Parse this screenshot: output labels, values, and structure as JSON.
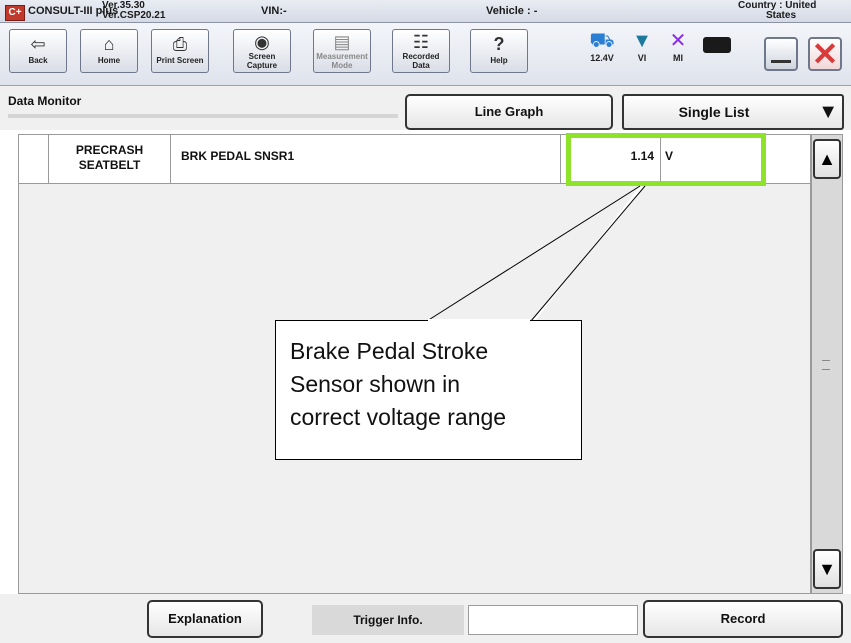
{
  "titlebar": {
    "app_name": "CONSULT-III plus",
    "version_line1": "Ver.35.30",
    "version_line2": "Ver.CSP20.21",
    "vin": "VIN:-",
    "vehicle": "Vehicle : -",
    "country_line1": "Country : United",
    "country_line2": "States",
    "logo_text": "C+"
  },
  "toolbar": {
    "buttons": [
      {
        "label": "Back",
        "icon": "back-arrow-icon"
      },
      {
        "label": "Home",
        "icon": "home-icon"
      },
      {
        "label": "Print Screen",
        "icon": "printer-icon"
      },
      {
        "label_line1": "Screen",
        "label_line2": "Capture",
        "icon": "camera-icon"
      },
      {
        "label_line1": "Measurement",
        "label_line2": "Mode",
        "icon": "measurement-icon",
        "disabled": true
      },
      {
        "label_line1": "Recorded",
        "label_line2": "Data",
        "icon": "recorded-data-icon"
      },
      {
        "label": "Help",
        "icon": "help-icon"
      }
    ],
    "status": {
      "battery_voltage": "12.4V",
      "vi": "VI",
      "mi": "MI"
    }
  },
  "panel": {
    "title": "Data Monitor",
    "line_graph_label": "Line Graph",
    "single_list_label": "Single List"
  },
  "table": {
    "rows": [
      {
        "system_line1": "PRECRASH",
        "system_line2": "SEATBELT",
        "item": "BRK PEDAL SNSR1",
        "value": "1.14",
        "unit": "V"
      }
    ]
  },
  "callout": {
    "line1": "Brake Pedal Stroke",
    "line2": "Sensor shown in",
    "line3": "correct voltage range"
  },
  "footer": {
    "explanation_label": "Explanation",
    "trigger_info_label": "Trigger Info.",
    "record_label": "Record"
  },
  "colors": {
    "highlight": "#8fe22a",
    "close_red": "#d93a3a",
    "car_blue": "#2a7fd4",
    "mi_purple": "#8a2be2"
  }
}
